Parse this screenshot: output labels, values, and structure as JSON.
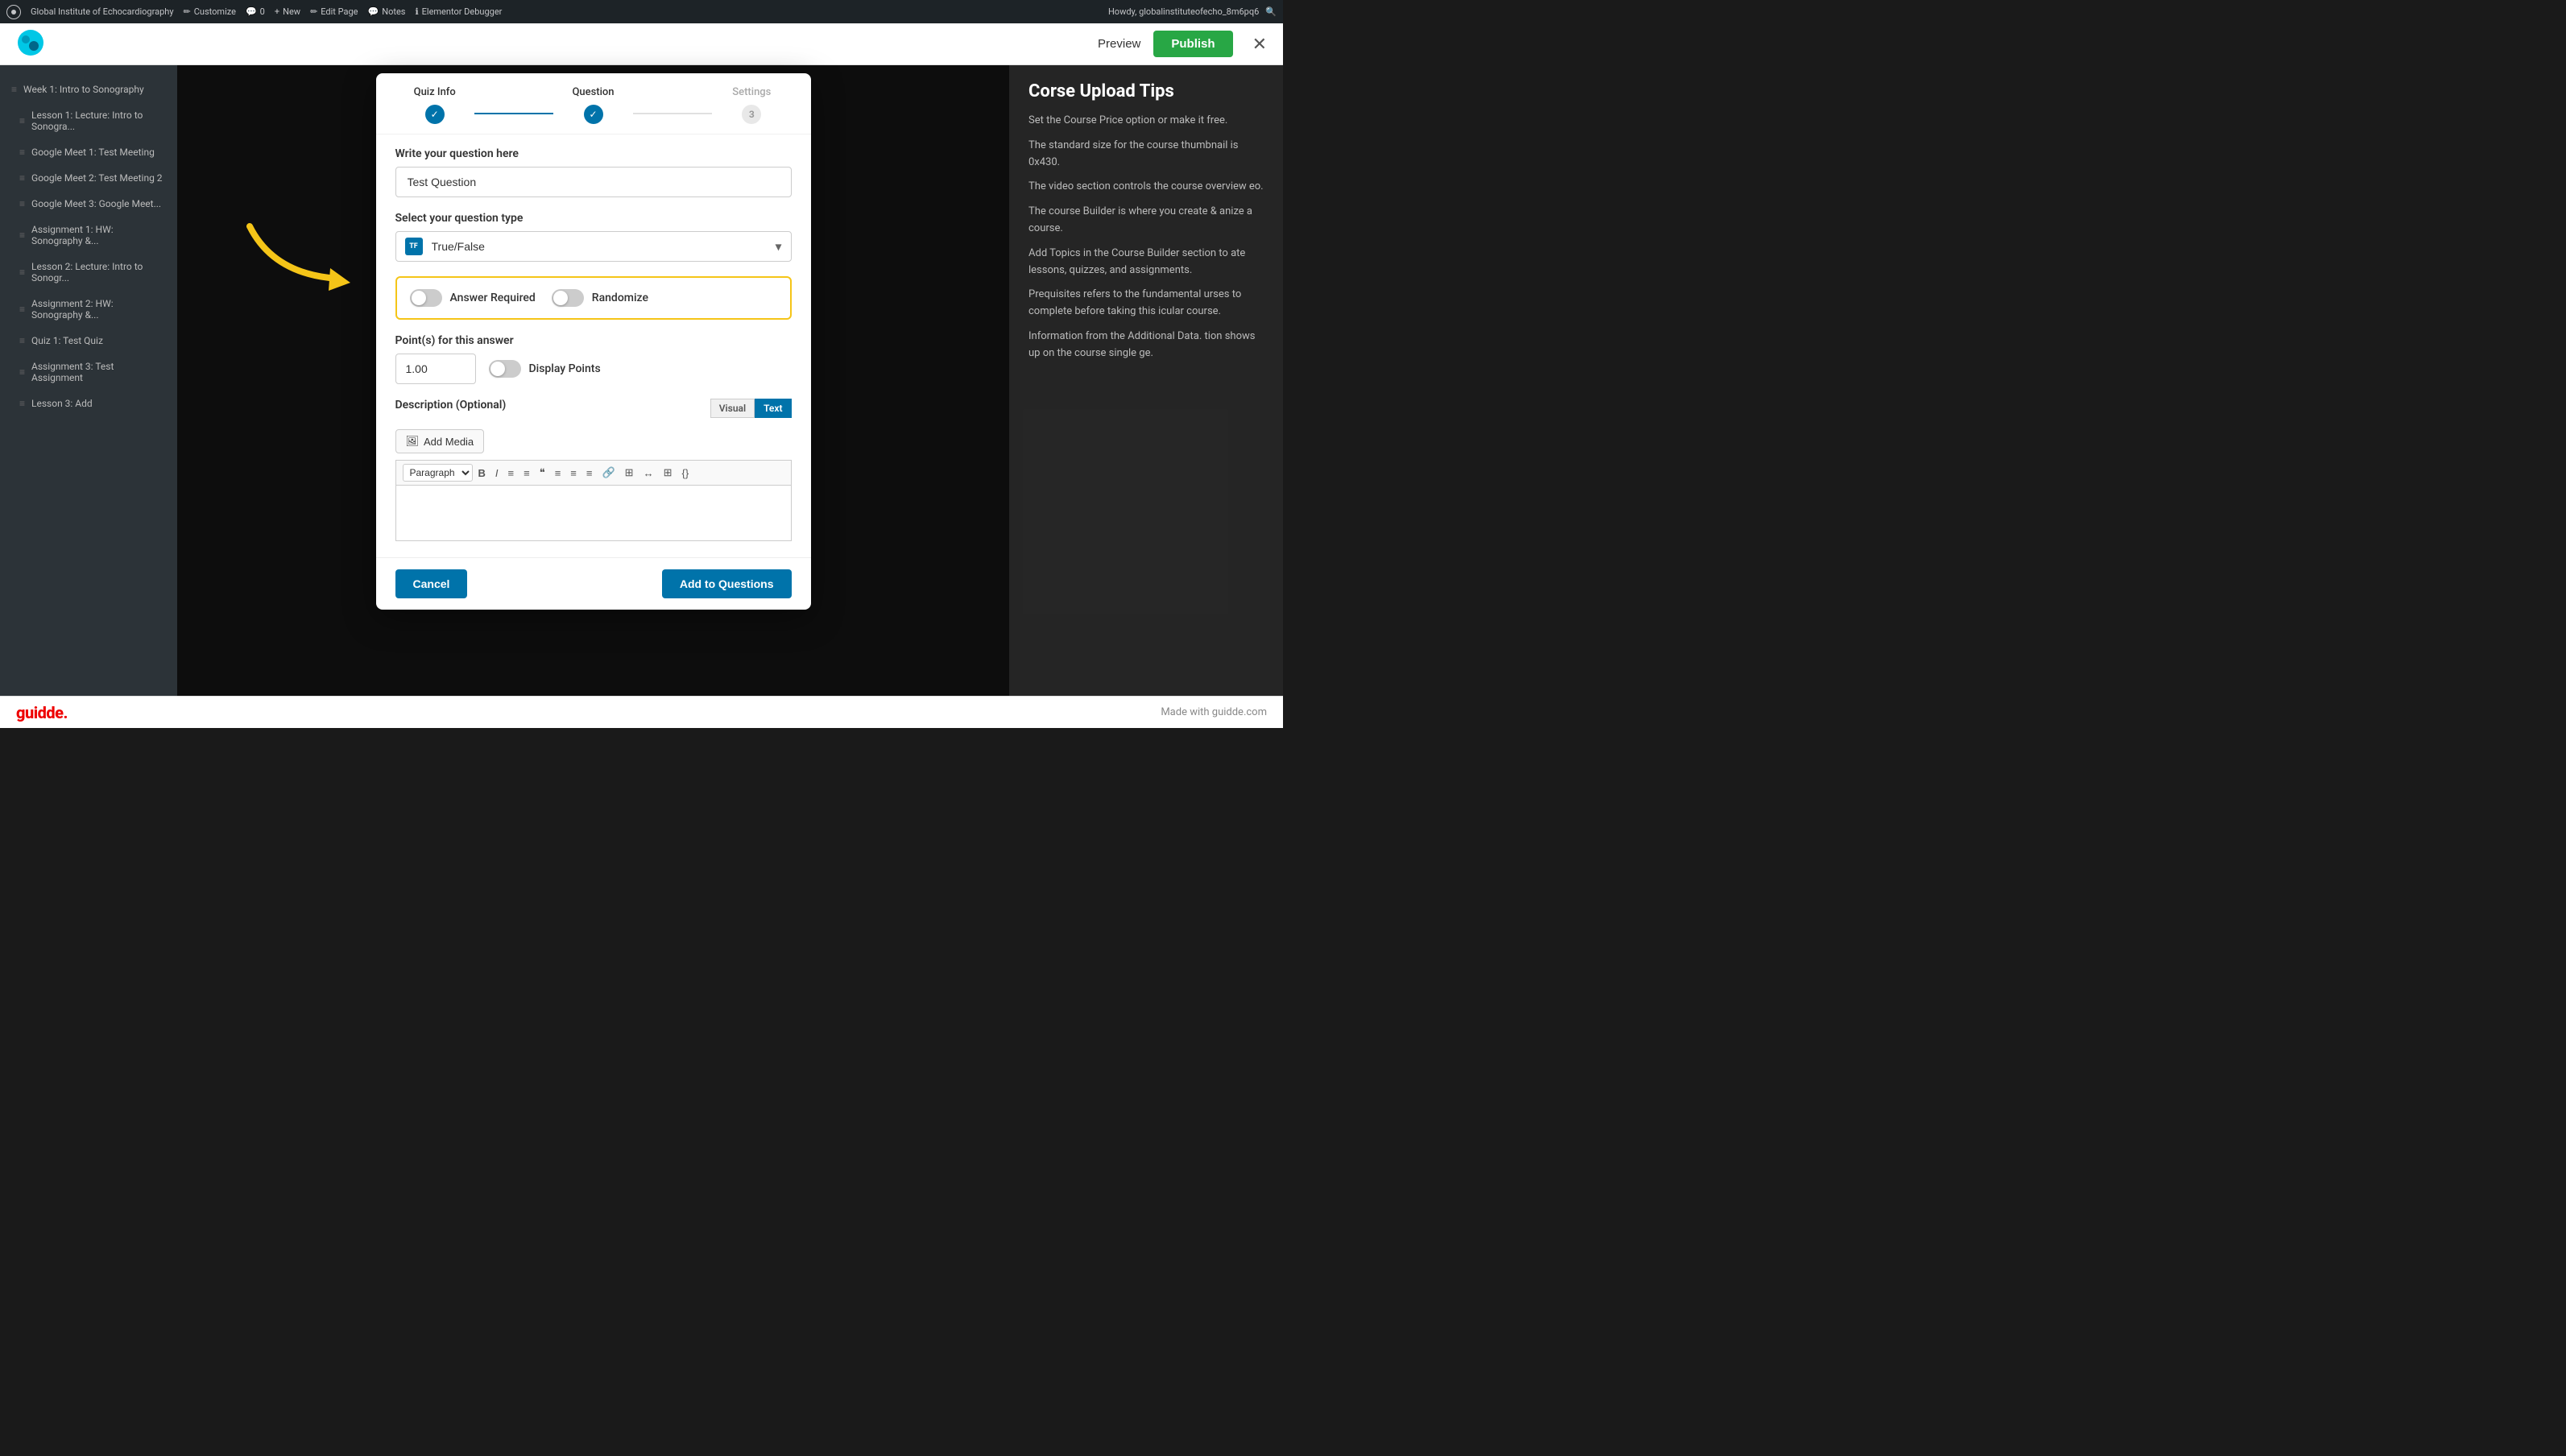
{
  "adminBar": {
    "wpLogo": "⊞",
    "siteName": "Global Institute of Echocardiography",
    "customize": "Customize",
    "comments": "0",
    "new": "New",
    "editPage": "Edit Page",
    "notes": "Notes",
    "elementorDebugger": "Elementor Debugger",
    "howdy": "Howdy, globalinstituteofecho_8m6pq6",
    "searchIcon": "🔍"
  },
  "header": {
    "previewLabel": "Preview",
    "publishLabel": "Publish",
    "closeIcon": "✕"
  },
  "sidebar": {
    "items": [
      {
        "label": "Week 1: Intro to Sonography"
      },
      {
        "label": "Lesson 1: Lecture: Intro to Sonogra..."
      },
      {
        "label": "Google Meet 1: Test Meeting"
      },
      {
        "label": "Google Meet 2: Test Meeting 2"
      },
      {
        "label": "Google Meet 3: Google Meet..."
      },
      {
        "label": "Assignment 1: HW: Sonography &..."
      },
      {
        "label": "Lesson 2: Lecture: Intro to Sonogr..."
      },
      {
        "label": "Assignment 2: HW: Sonography &..."
      },
      {
        "label": "Quiz 1: Test Quiz"
      },
      {
        "label": "Assignment 3: Test Assignment"
      },
      {
        "label": "Lesson 3: Add"
      }
    ]
  },
  "modal": {
    "steps": [
      {
        "label": "Quiz Info",
        "completed": true,
        "number": "✓"
      },
      {
        "label": "Question",
        "completed": true,
        "number": "✓"
      },
      {
        "label": "Settings",
        "completed": false,
        "number": "3"
      }
    ],
    "questionLabel": "Write your question here",
    "questionPlaceholder": "Test Question",
    "questionTypeLabel": "Select your question type",
    "questionTypeValue": "True/False",
    "questionTypeIcon": "TF",
    "toggles": {
      "answerRequired": "Answer Required",
      "randomize": "Randomize"
    },
    "pointsLabel": "Point(s) for this answer",
    "pointsValue": "1.00",
    "displayPoints": "Display Points",
    "descriptionLabel": "Description (Optional)",
    "addMediaLabel": "Add Media",
    "visualTab": "Visual",
    "textTab": "Text",
    "toolbarItems": [
      "Paragraph",
      "B",
      "I",
      "≡",
      "≡",
      "❝",
      "≡",
      "≡",
      "≡",
      "🔗",
      "⊞",
      "↔",
      "⊞",
      "{}"
    ],
    "cancelLabel": "Cancel",
    "addToQuestionsLabel": "Add to Questions"
  },
  "rightSidebar": {
    "title": "rse Upload Tips",
    "paragraphs": [
      "the Course Price option or make it free.",
      "andard size for the course thumbnail is 0x430.",
      "eo section controls the course overview eo.",
      "urse Builder is where you create & anize a course.",
      "d Topics in the Course Builder section to ate lessons, quizzes, and assignments.",
      "equisites refers to the fundamental urses to complete before taking this icular course.",
      "ormation from the Additional Data. tion shows up on the course single ge."
    ]
  },
  "bottomBar": {
    "guidde": "guidde.",
    "madeWith": "Made with guidde.com"
  }
}
